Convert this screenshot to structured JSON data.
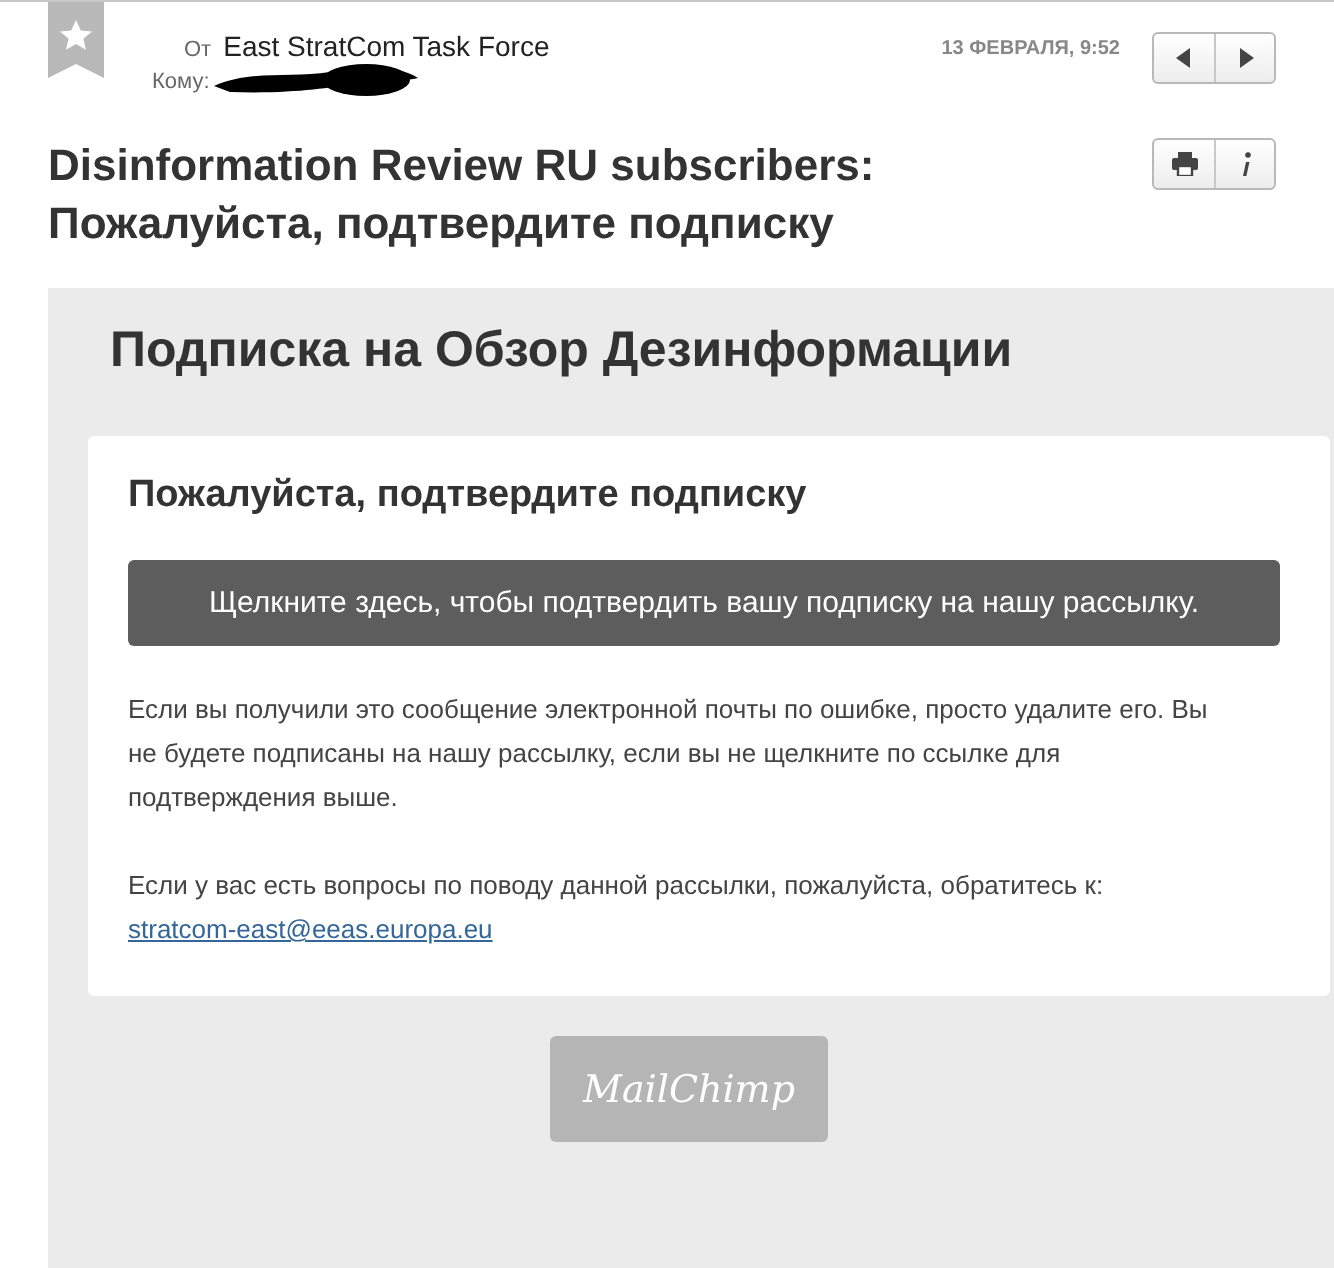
{
  "header": {
    "from_label": "От",
    "from": "East StratCom Task Force",
    "to_label": "Кому:",
    "date": "13 ФЕВРАЛЯ, 9:52"
  },
  "subject_lines": [
    "Disinformation Review RU subscribers:",
    "Пожалуйста, подтвердите подписку"
  ],
  "email": {
    "heading": "Подписка на Обзор Дезинформации",
    "card_heading": "Пожалуйста, подтвердите подписку",
    "confirm_button": "Щелкните здесь, чтобы подтвердить вашу подписку на нашу рассылку.",
    "notice": "Если вы получили это сообщение электронной почты по ошибке, просто удалите его. Вы не будете подписаны на нашу рассылку, если вы не щелкните по ссылке для подтверждения выше.",
    "contact_text": "Если у вас есть вопросы по поводу данной рассылки, пожалуйста, обратитесь к:",
    "contact_email": "stratcom-east@eeas.europa.eu",
    "footer_logo": "MailChimp"
  }
}
